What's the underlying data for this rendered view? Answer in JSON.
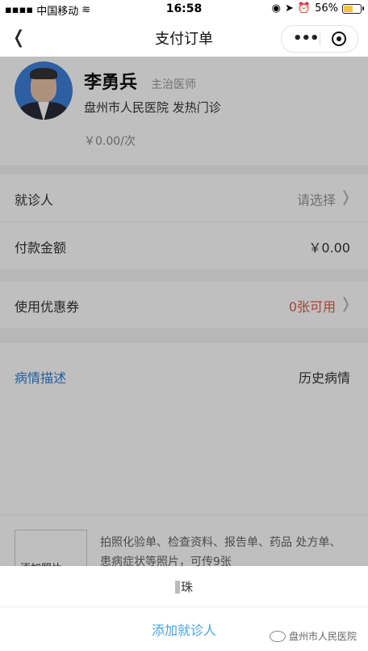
{
  "status_bar": {
    "carrier": "中国移动",
    "time": "16:58",
    "battery": "56%",
    "battery_level": 0.56
  },
  "nav": {
    "title": "支付订单"
  },
  "doctor": {
    "name": "李勇兵",
    "title": "主治医师",
    "hospital": "盘州市人民医院 发热门诊",
    "price": "￥0.00/次"
  },
  "rows": {
    "patient_label": "就诊人",
    "patient_value": "请选择",
    "amount_label": "付款金额",
    "amount_value": "￥0.00",
    "coupon_label": "使用优惠券",
    "coupon_value": "0张可用"
  },
  "description": {
    "title": "病情描述",
    "history": "历史病情",
    "upload_label": "添加照片",
    "upload_hint": "拍照化验单、检查资料、报告单、药品 处方单、患病症状等照片，可传9张"
  },
  "sheet": {
    "item_name": "珠",
    "add_patient": "添加就诊人"
  },
  "watermark": "盘州市人民医院",
  "colors": {
    "accent_blue": "#2d7fd6",
    "coupon_red": "#e15a4a",
    "add_blue": "#4aa3e8"
  }
}
